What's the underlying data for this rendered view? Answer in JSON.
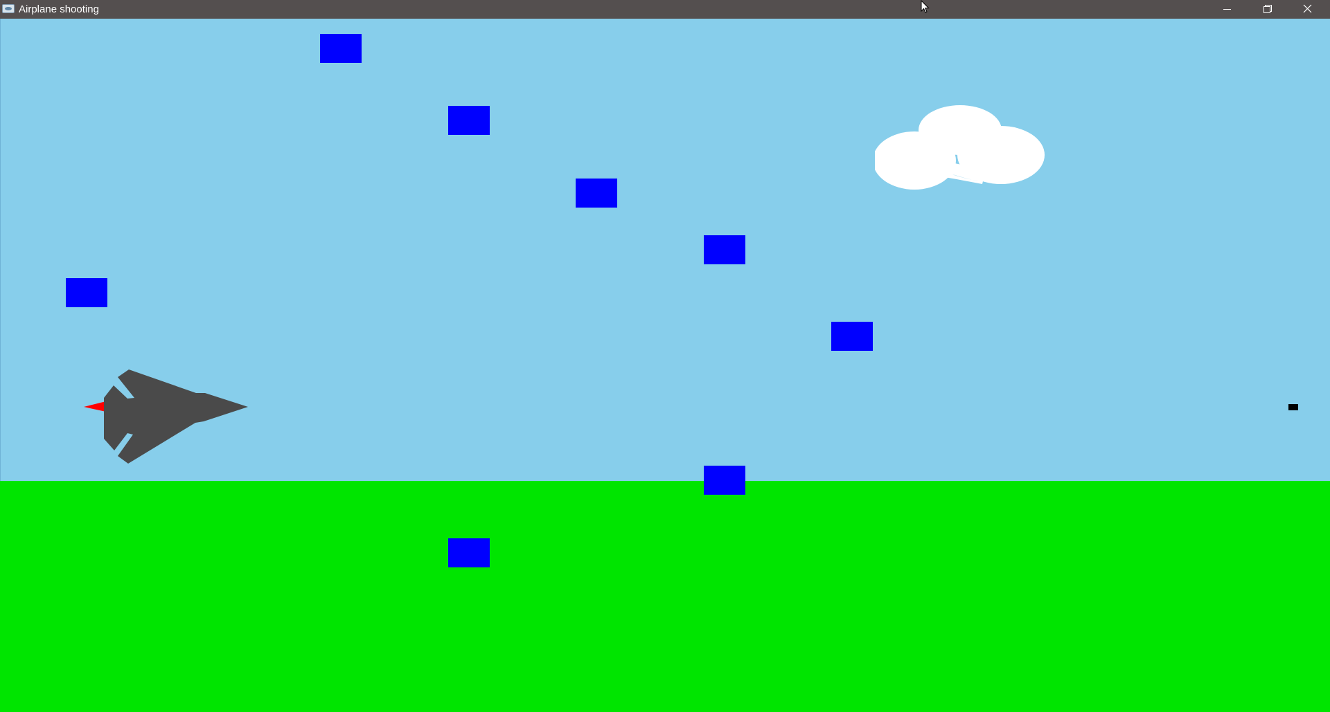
{
  "window": {
    "title": "Airplane shooting",
    "icons": {
      "app": "app-icon",
      "minimize": "minimize-icon",
      "maximize": "maximize-icon",
      "close": "close-icon"
    }
  },
  "scene": {
    "colors": {
      "titlebar": "#544f4f",
      "sky": "#87ceeb",
      "ground": "#00e500",
      "target": "#0000ff",
      "plane_body": "#4a4a4a",
      "exhaust": "#ff0000",
      "cloud": "#ffffff",
      "bullet": "#000000"
    },
    "targets_count": 8
  }
}
